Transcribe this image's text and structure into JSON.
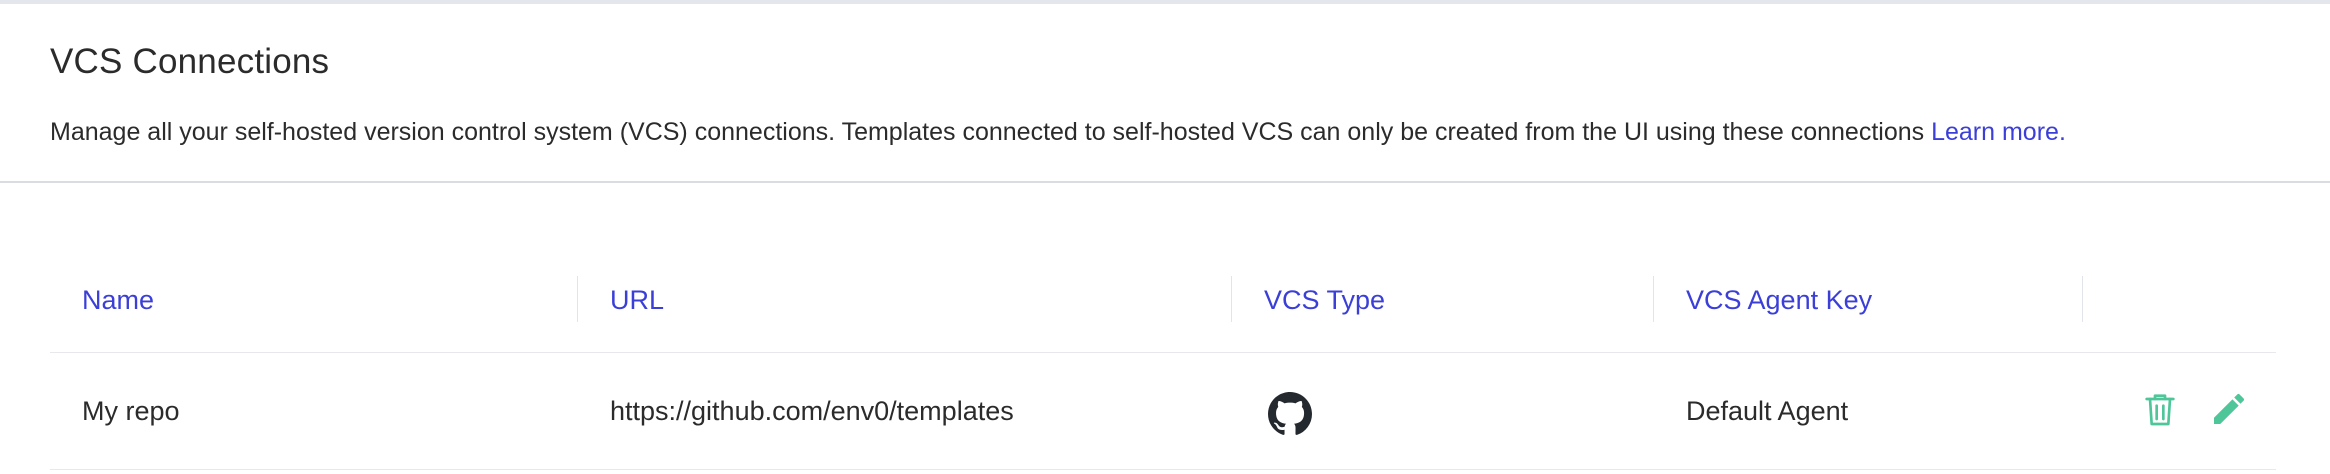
{
  "header": {
    "title": "VCS Connections",
    "description": "Manage all your self-hosted version control system (VCS) connections. Templates connected to self-hosted VCS can only be created from the UI using these connections",
    "learn_more": "Learn more",
    "period": "."
  },
  "table": {
    "columns": [
      "Name",
      "URL",
      "VCS Type",
      "VCS Agent Key"
    ],
    "rows": [
      {
        "name": "My repo",
        "url": "https://github.com/env0/templates",
        "vcs_type_icon": "github-icon",
        "agent_key": "Default Agent",
        "actions": [
          "delete-icon",
          "edit-icon"
        ]
      }
    ]
  },
  "colors": {
    "accent": "#3b3fd8",
    "action_icon": "#4fc69a",
    "text": "#2b2b2b"
  }
}
